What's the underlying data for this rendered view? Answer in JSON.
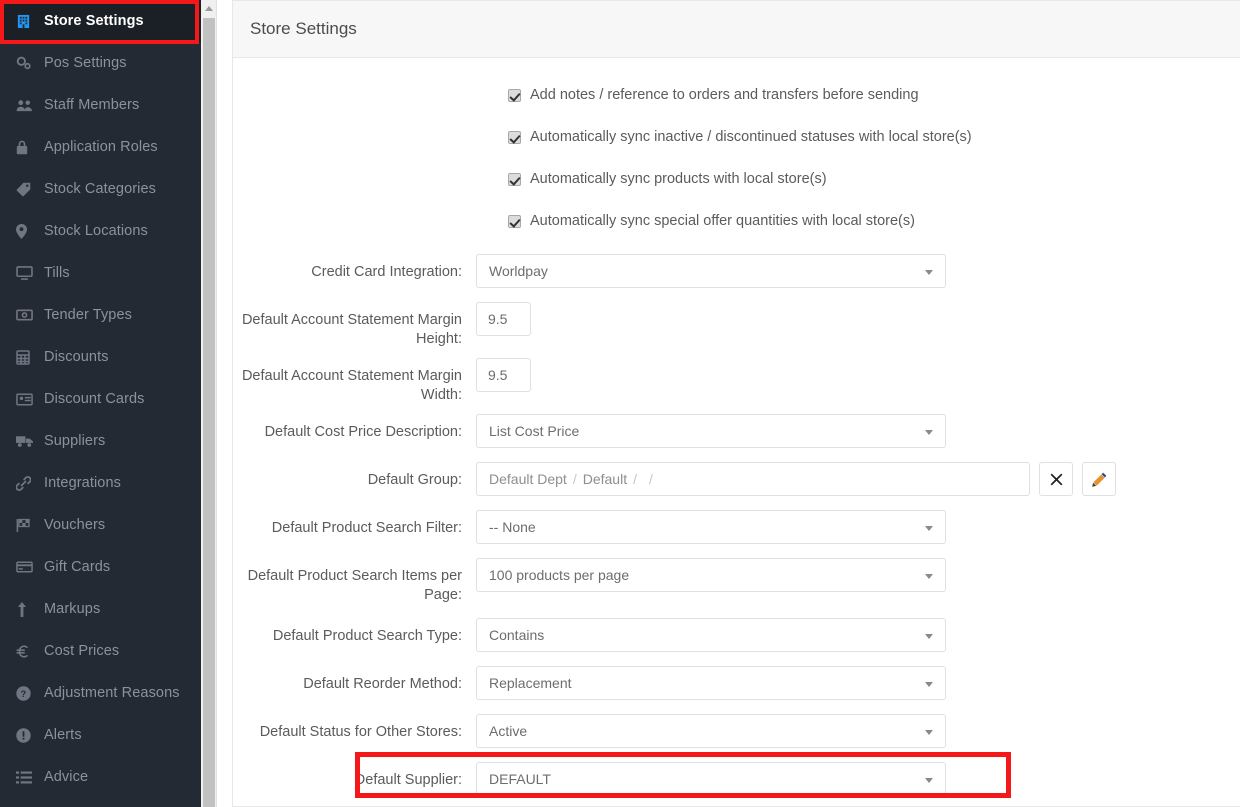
{
  "sidebar": {
    "items": [
      {
        "label": "Store Settings",
        "icon": "building-icon",
        "active": true
      },
      {
        "label": "Pos Settings",
        "icon": "cogs-icon",
        "active": false
      },
      {
        "label": "Staff Members",
        "icon": "users-icon",
        "active": false
      },
      {
        "label": "Application Roles",
        "icon": "lock-icon",
        "active": false
      },
      {
        "label": "Stock Categories",
        "icon": "tag-icon",
        "active": false
      },
      {
        "label": "Stock Locations",
        "icon": "map-marker-icon",
        "active": false
      },
      {
        "label": "Tills",
        "icon": "desktop-icon",
        "active": false
      },
      {
        "label": "Tender Types",
        "icon": "money-icon",
        "active": false
      },
      {
        "label": "Discounts",
        "icon": "calculator-icon",
        "active": false
      },
      {
        "label": "Discount Cards",
        "icon": "id-card-icon",
        "active": false
      },
      {
        "label": "Suppliers",
        "icon": "truck-icon",
        "active": false
      },
      {
        "label": "Integrations",
        "icon": "link-icon",
        "active": false
      },
      {
        "label": "Vouchers",
        "icon": "flag-checkered-icon",
        "active": false
      },
      {
        "label": "Gift Cards",
        "icon": "credit-card-icon",
        "active": false
      },
      {
        "label": "Markups",
        "icon": "arrow-up-icon",
        "active": false
      },
      {
        "label": "Cost Prices",
        "icon": "euro-icon",
        "active": false
      },
      {
        "label": "Adjustment Reasons",
        "icon": "question-circle-icon",
        "active": false
      },
      {
        "label": "Alerts",
        "icon": "exclamation-circle-icon",
        "active": false
      },
      {
        "label": "Advice",
        "icon": "list-icon",
        "active": false
      }
    ]
  },
  "panel": {
    "title": "Store Settings"
  },
  "checkboxes": [
    {
      "label": "Add notes / reference to orders and transfers before sending",
      "checked": true
    },
    {
      "label": "Automatically sync inactive / discontinued statuses with local store(s)",
      "checked": true
    },
    {
      "label": "Automatically sync products with local store(s)",
      "checked": true
    },
    {
      "label": "Automatically sync special offer quantities with local store(s)",
      "checked": true
    }
  ],
  "fields": {
    "credit_card_integration": {
      "label": "Credit Card Integration:",
      "value": "Worldpay"
    },
    "margin_height": {
      "label": "Default Account Statement Margin Height:",
      "value": "9.5"
    },
    "margin_width": {
      "label": "Default Account Statement Margin Width:",
      "value": "9.5"
    },
    "cost_price_description": {
      "label": "Default Cost Price Description:",
      "value": "List Cost Price"
    },
    "default_group": {
      "label": "Default Group:",
      "segments": [
        "Default Dept",
        "Default",
        "",
        ""
      ],
      "clear_button": "✖",
      "edit_button": "pencil"
    },
    "product_search_filter": {
      "label": "Default Product Search Filter:",
      "value": "-- None"
    },
    "product_search_items": {
      "label": "Default Product Search Items per Page:",
      "value": "100 products per page"
    },
    "product_search_type": {
      "label": "Default Product Search Type:",
      "value": "Contains"
    },
    "reorder_method": {
      "label": "Default Reorder Method:",
      "value": "Replacement"
    },
    "status_other_stores": {
      "label": "Default Status for Other Stores:",
      "value": "Active"
    },
    "default_supplier": {
      "label": "Default Supplier:",
      "value": "DEFAULT"
    }
  },
  "colors": {
    "sidebar_bg": "#242a33",
    "sidebar_active_bg": "#1b2027",
    "sidebar_text": "#8b929c",
    "accent_blue": "#2196f3",
    "annotation_red": "#f41818",
    "panel_header_bg": "#f7f7f7",
    "border": "#e7e7e7"
  }
}
